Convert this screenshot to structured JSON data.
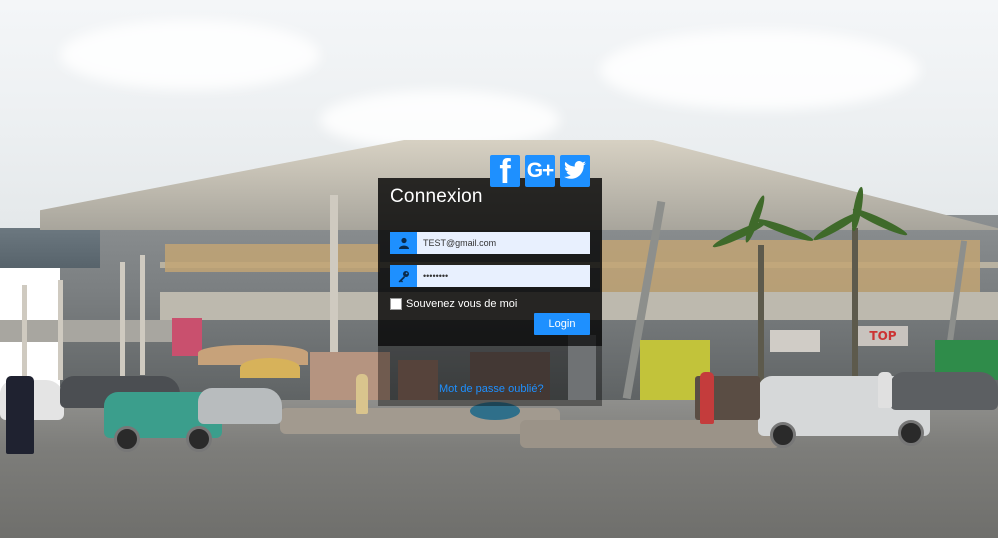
{
  "background": {
    "scene": "outdoor market building photo",
    "sign_text": "TOP"
  },
  "social": {
    "facebook": {
      "label": "f",
      "icon": "facebook-icon"
    },
    "google": {
      "label": "G+",
      "icon": "google-plus-icon"
    },
    "twitter": {
      "label": "",
      "icon": "twitter-icon"
    }
  },
  "login": {
    "title": "Connexion",
    "email_value": "TEST@gmail.com",
    "password_value": "••••••••",
    "remember_label": "Souvenez vous de moi",
    "remember_checked": false,
    "submit_label": "Login",
    "forgot_label": "Mot de passe oublié?"
  },
  "colors": {
    "accent": "#1e90ff",
    "panel": "rgba(0,0,0,0.80)",
    "input_bg": "#e8f0fe"
  }
}
